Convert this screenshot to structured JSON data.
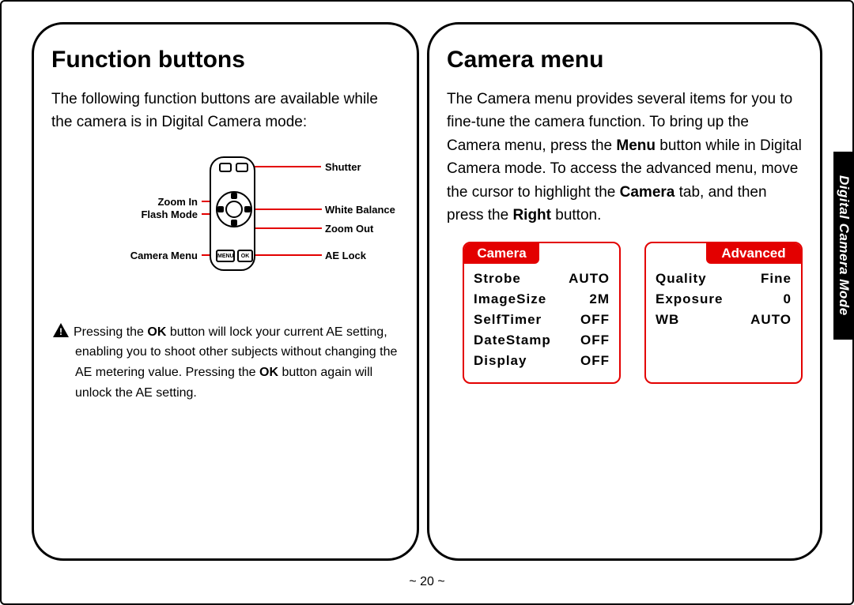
{
  "page_number": "~ 20 ~",
  "side_tab": "Digital Camera Mode",
  "left": {
    "title": "Function buttons",
    "intro": "The following function buttons are available while the camera is in Digital Camera mode:",
    "labels": {
      "shutter": "Shutter",
      "white_balance": "White Balance",
      "zoom_out": "Zoom Out",
      "ae_lock": "AE Lock",
      "zoom_in": "Zoom In",
      "flash_mode": "Flash Mode",
      "camera_menu": "Camera Menu",
      "menu_btn": "MENU",
      "ok_btn": "OK"
    },
    "note_parts": {
      "p1": "Pressing the ",
      "b1": "OK",
      "p2": " button will lock your current AE setting, enabling you to shoot other subjects without changing the AE metering value. Pressing the ",
      "b2": "OK",
      "p3": " button again will unlock the AE setting."
    }
  },
  "right": {
    "title": "Camera menu",
    "intro_parts": {
      "p1": "The Camera menu provides several items for you to fine-tune the camera function. To bring up the Camera menu, press the ",
      "b1": "Menu",
      "p2": " button while in Digital Camera mode. To access the advanced menu, move the cursor to highlight the ",
      "b2": "Camera",
      "p3": " tab, and then press the ",
      "b3": "Right",
      "p4": " button."
    },
    "camera_tab": "Camera",
    "advanced_tab": "Advanced",
    "camera_menu": [
      {
        "label": "Strobe",
        "value": "AUTO"
      },
      {
        "label": "ImageSize",
        "value": "2M"
      },
      {
        "label": "SelfTimer",
        "value": "OFF"
      },
      {
        "label": "DateStamp",
        "value": "OFF"
      },
      {
        "label": "Display",
        "value": "OFF"
      }
    ],
    "advanced_menu": [
      {
        "label": "Quality",
        "value": "Fine"
      },
      {
        "label": "Exposure",
        "value": "0"
      },
      {
        "label": "WB",
        "value": "AUTO"
      }
    ]
  }
}
